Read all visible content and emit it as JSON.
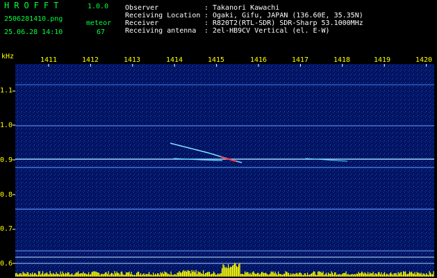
{
  "header": {
    "brand": "HROFFT",
    "version": "1.0.0",
    "filename": "2506281410.png",
    "mode_label": "meteor",
    "datetime": "25.06.28 14:10",
    "count": "67"
  },
  "station": [
    {
      "label": "Observer",
      "value": "Takanori Kawachi"
    },
    {
      "label": "Receiving Location",
      "value": "Ogaki, Gifu, JAPAN (136.60E, 35.35N)"
    },
    {
      "label": "Receiver",
      "value": "R820T2(RTL-SDR) SDR-Sharp 53.1000MHz"
    },
    {
      "label": "Receiving antenna",
      "value": "2el-HB9CV Vertical (el. E-W)"
    }
  ],
  "axis": {
    "unit": "kHz",
    "x_ticks": [
      "1411",
      "1412",
      "1413",
      "1414",
      "1415",
      "1416",
      "1417",
      "1418",
      "1419",
      "1420"
    ],
    "y_ticks": [
      "1.1",
      "1.0",
      "0.9",
      "0.8",
      "0.7",
      "0.6"
    ]
  },
  "colors": {
    "background": "#000000",
    "plot_bg": "#001066",
    "header_green": "#00ff3c",
    "label_yellow": "#ffff00",
    "trace_cyan": "#60d8ff",
    "power_yellow": "#ffff00"
  }
}
